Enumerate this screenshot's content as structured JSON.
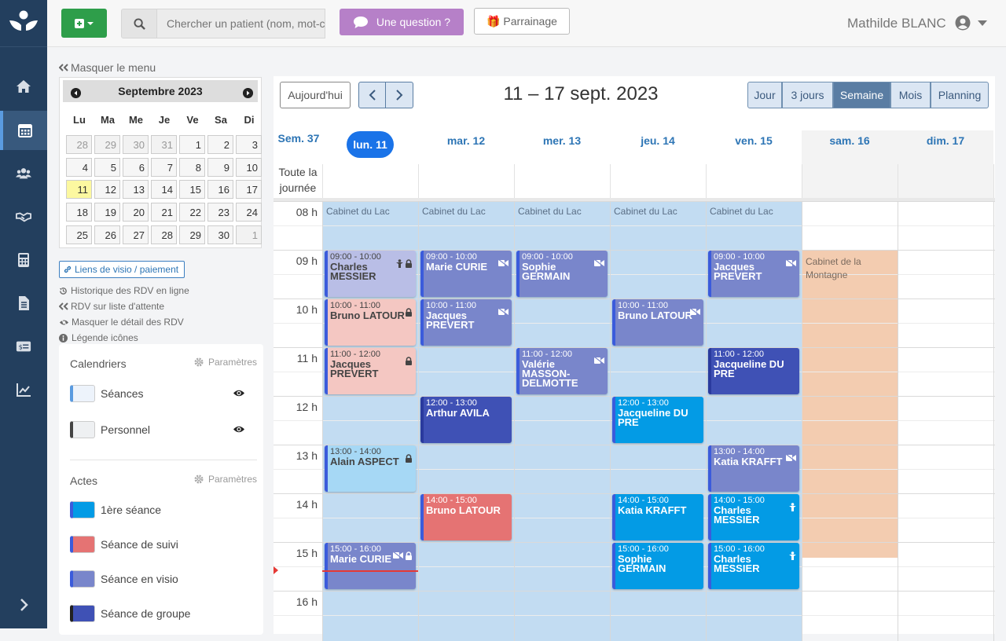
{
  "search": {
    "placeholder": "Chercher un patient (nom, mot-clé...)"
  },
  "topbar": {
    "question": "Une question ?",
    "referral": "🎁 Parrainage",
    "user": "Mathilde BLANC"
  },
  "menu": {
    "hide": "Masquer le menu"
  },
  "mini_cal": {
    "month": "Septembre 2023",
    "days": [
      "Lu",
      "Ma",
      "Me",
      "Je",
      "Ve",
      "Sa",
      "Di"
    ],
    "weeks": [
      [
        "28",
        "29",
        "30",
        "31",
        "1",
        "2",
        "3"
      ],
      [
        "4",
        "5",
        "6",
        "7",
        "8",
        "9",
        "10"
      ],
      [
        "11",
        "12",
        "13",
        "14",
        "15",
        "16",
        "17"
      ],
      [
        "18",
        "19",
        "20",
        "21",
        "22",
        "23",
        "24"
      ],
      [
        "25",
        "26",
        "27",
        "28",
        "29",
        "30",
        "1"
      ]
    ]
  },
  "links": {
    "visio": "Liens de visio / paiement",
    "history": "Historique des RDV en ligne",
    "waitlist": "RDV sur liste d'attente",
    "hide_detail": "Masquer le détail des RDV",
    "legend": "Légende icônes"
  },
  "panel": {
    "calendars_title": "Calendriers",
    "settings": "Paramètres",
    "calendars": [
      "Séances",
      "Personnel"
    ],
    "acts_title": "Actes",
    "acts": [
      "1ère séance",
      "Séance de suivi",
      "Séance en visio",
      "Séance de groupe"
    ]
  },
  "toolbar": {
    "today": "Aujourd'hui",
    "range": "11 – 17 sept. 2023",
    "views": [
      "Jour",
      "3 jours",
      "Semaine",
      "Mois",
      "Planning"
    ],
    "active_view": "Semaine"
  },
  "week": {
    "label": "Sem. 37",
    "allday": "Toute la journée",
    "days": [
      "lun. 11",
      "mar. 12",
      "mer. 13",
      "jeu. 14",
      "ven. 15",
      "sam. 16",
      "dim. 17"
    ],
    "hours": [
      "08 h",
      "09 h",
      "10 h",
      "11 h",
      "12 h",
      "13 h",
      "14 h",
      "15 h",
      "16 h"
    ],
    "cabinet": [
      "Cabinet du Lac",
      "Cabinet du Lac",
      "Cabinet du Lac",
      "Cabinet du Lac",
      "Cabinet du Lac",
      "Cabinet de la Montagne"
    ]
  },
  "events": [
    {
      "day": 0,
      "start": 9,
      "end": 10,
      "time": "09:00 - 10:00",
      "name": "Charles MESSIER",
      "kind": "visio",
      "faded": true,
      "icons": [
        "group",
        "lock"
      ]
    },
    {
      "day": 0,
      "start": 10,
      "end": 11,
      "time": "10:00 - 11:00",
      "name": "Bruno LATOUR",
      "kind": "suivi",
      "faded": true,
      "icons": [
        "lock"
      ]
    },
    {
      "day": 0,
      "start": 11,
      "end": 12,
      "time": "11:00 - 12:00",
      "name": "Jacques PREVERT",
      "kind": "suivi",
      "faded": true,
      "icons": [
        "lock"
      ]
    },
    {
      "day": 0,
      "start": 13,
      "end": 14,
      "time": "13:00 - 14:00",
      "name": "Alain ASPECT",
      "kind": "premiere",
      "faded": true,
      "icons": [
        "lock"
      ]
    },
    {
      "day": 0,
      "start": 15,
      "end": 16,
      "time": "15:00 - 16:00",
      "name": "Marie CURIE",
      "kind": "visio",
      "faded": false,
      "icons": [
        "video",
        "lock"
      ]
    },
    {
      "day": 1,
      "start": 9,
      "end": 10,
      "time": "09:00 - 10:00",
      "name": "Marie CURIE",
      "kind": "visio",
      "faded": false,
      "icons": [
        "video"
      ]
    },
    {
      "day": 1,
      "start": 10,
      "end": 11,
      "time": "10:00 - 11:00",
      "name": "Jacques PREVERT",
      "kind": "visio",
      "faded": false,
      "icons": [
        "video"
      ]
    },
    {
      "day": 1,
      "start": 12,
      "end": 13,
      "time": "12:00 - 13:00",
      "name": "Arthur AVILA",
      "kind": "groupe",
      "faded": false,
      "icons": []
    },
    {
      "day": 1,
      "start": 14,
      "end": 15,
      "time": "14:00 - 15:00",
      "name": "Bruno LATOUR",
      "kind": "suivi",
      "faded": false,
      "icons": []
    },
    {
      "day": 2,
      "start": 9,
      "end": 10,
      "time": "09:00 - 10:00",
      "name": "Sophie GERMAIN",
      "kind": "visio",
      "faded": false,
      "icons": [
        "video"
      ]
    },
    {
      "day": 2,
      "start": 11,
      "end": 12,
      "time": "11:00 - 12:00",
      "name": "Valérie MASSON-DELMOTTE",
      "kind": "visio",
      "faded": false,
      "icons": [
        "video"
      ]
    },
    {
      "day": 3,
      "start": 10,
      "end": 11,
      "time": "10:00 - 11:00",
      "name": "Bruno LATOUR",
      "kind": "visio",
      "faded": false,
      "icons": [
        "video"
      ]
    },
    {
      "day": 3,
      "start": 12,
      "end": 13,
      "time": "12:00 - 13:00",
      "name": "Jacqueline DU PRE",
      "kind": "premiere",
      "faded": false,
      "icons": []
    },
    {
      "day": 3,
      "start": 14,
      "end": 15,
      "time": "14:00 - 15:00",
      "name": "Katia KRAFFT",
      "kind": "premiere",
      "faded": false,
      "icons": []
    },
    {
      "day": 3,
      "start": 15,
      "end": 16,
      "time": "15:00 - 16:00",
      "name": "Sophie GERMAIN",
      "kind": "premiere",
      "faded": false,
      "icons": []
    },
    {
      "day": 4,
      "start": 9,
      "end": 10,
      "time": "09:00 - 10:00",
      "name": "Jacques PREVERT",
      "kind": "visio",
      "faded": false,
      "icons": [
        "video"
      ]
    },
    {
      "day": 4,
      "start": 11,
      "end": 12,
      "time": "11:00 - 12:00",
      "name": "Jacqueline DU PRE",
      "kind": "groupe",
      "faded": false,
      "icons": []
    },
    {
      "day": 4,
      "start": 13,
      "end": 14,
      "time": "13:00 - 14:00",
      "name": "Katia KRAFFT",
      "kind": "visio",
      "faded": false,
      "icons": [
        "video"
      ]
    },
    {
      "day": 4,
      "start": 14,
      "end": 15,
      "time": "14:00 - 15:00",
      "name": "Charles MESSIER",
      "kind": "premiere",
      "faded": false,
      "icons": [
        "group"
      ]
    },
    {
      "day": 4,
      "start": 15,
      "end": 16,
      "time": "15:00 - 16:00",
      "name": "Charles MESSIER",
      "kind": "premiere",
      "faded": false,
      "icons": [
        "group"
      ]
    }
  ],
  "colors": {
    "premiere": "#039be5",
    "suivi": "#e57373",
    "visio": "#7986cb",
    "groupe": "#3f51b5",
    "premiere_faded": "#a6d8f5",
    "suivi_faded": "#f4c7c2",
    "visio_faded": "#b9bee6",
    "working_hours": "#c2dcf2",
    "montagne": "#f3ccb0",
    "now_line": "#e53935"
  }
}
